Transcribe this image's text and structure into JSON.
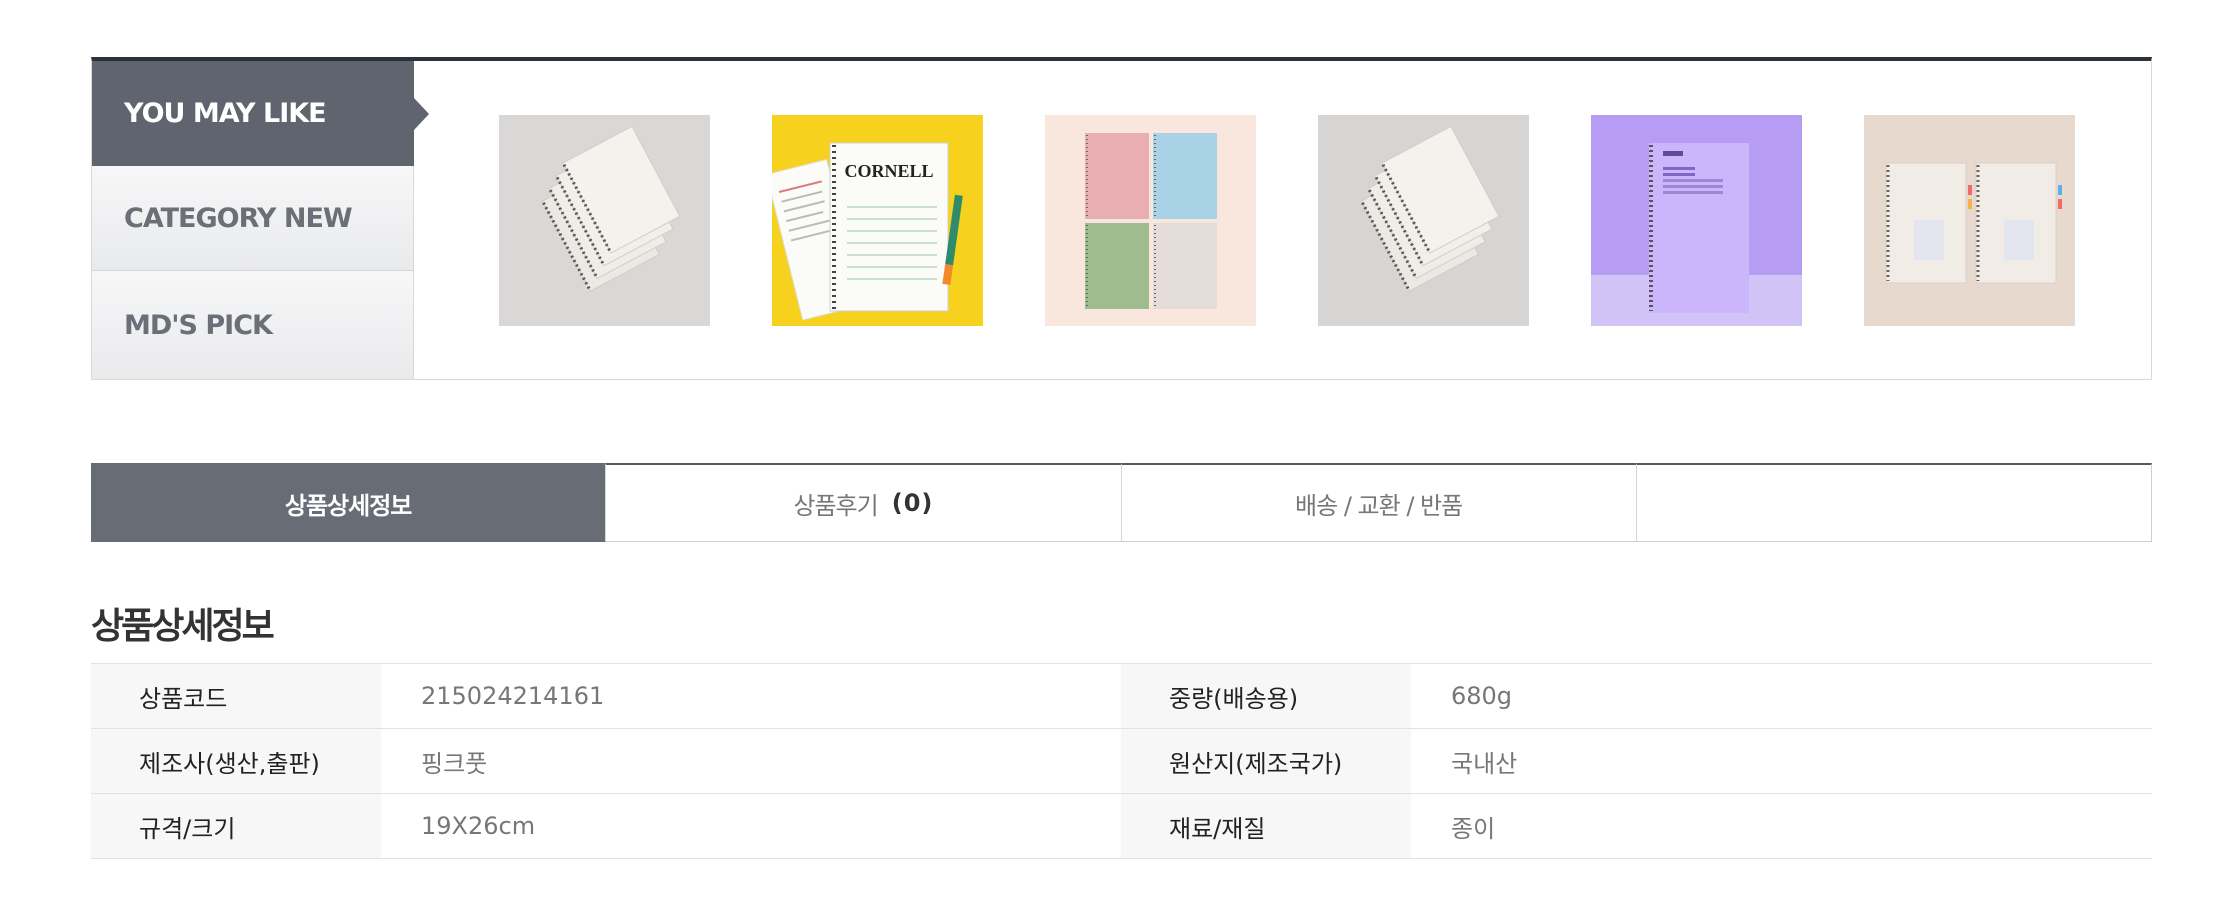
{
  "recommend": {
    "tabs": [
      {
        "label": "YOU MAY LIKE",
        "active": true
      },
      {
        "label": "CATEGORY NEW",
        "active": false
      },
      {
        "label": "MD'S PICK",
        "active": false
      }
    ],
    "products": [
      {
        "name": "gray-spiral-notebooks-stack"
      },
      {
        "name": "cornell-notebook-yellow"
      },
      {
        "name": "pastel-four-notebooks"
      },
      {
        "name": "gray-spiral-notebooks-stack-2"
      },
      {
        "name": "purple-spiral-notebook"
      },
      {
        "name": "beige-two-notebooks"
      }
    ],
    "cornell_text": "CORNELL",
    "accent": "#2b323c"
  },
  "detail_tabs": [
    {
      "label": "상품상세정보",
      "active": true
    },
    {
      "label": "상품후기",
      "count": "(0)",
      "active": false
    },
    {
      "label": "배송 / 교환 / 반품",
      "active": false
    },
    {
      "label": "",
      "active": false
    }
  ],
  "info": {
    "title": "상품상세정보",
    "rows": [
      {
        "k1": "상품코드",
        "v1": "215024214161",
        "k2": "중량(배송용)",
        "v2": "680g"
      },
      {
        "k1": "제조사(생산,출판)",
        "v1": "핑크풋",
        "k2": "원산지(제조국가)",
        "v2": "국내산"
      },
      {
        "k1": "규격/크기",
        "v1": "19X26cm",
        "k2": "재료/재질",
        "v2": "종이"
      }
    ]
  }
}
